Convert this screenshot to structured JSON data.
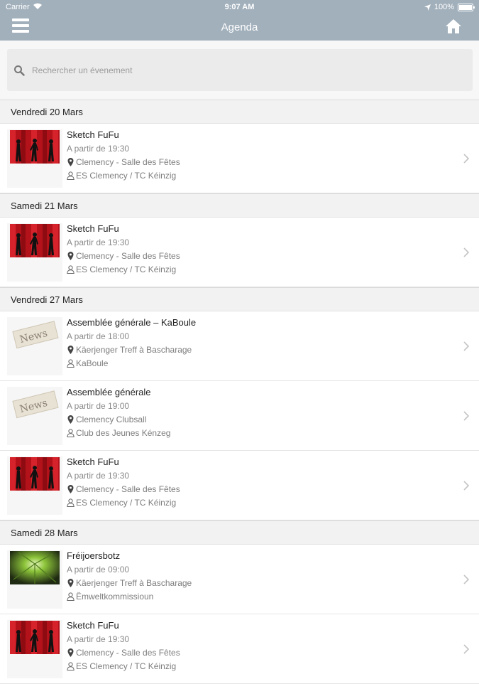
{
  "status_bar": {
    "carrier": "Carrier",
    "time": "9:07 AM",
    "battery": "100%"
  },
  "nav": {
    "title": "Agenda"
  },
  "search": {
    "placeholder": "Rechercher un évenement"
  },
  "sections": [
    {
      "date": "Vendredi 20 Mars",
      "events": [
        {
          "title": "Sketch FuFu",
          "time": "A partir de 19:30",
          "place": "Clemency - Salle des Fêtes",
          "organizer": "ES Clemency / TC Kéinzig",
          "image": "theatre"
        }
      ]
    },
    {
      "date": "Samedi 21 Mars",
      "events": [
        {
          "title": "Sketch FuFu",
          "time": "A partir de 19:30",
          "place": "Clemency - Salle des Fêtes",
          "organizer": "ES Clemency / TC Kéinzig",
          "image": "theatre"
        }
      ]
    },
    {
      "date": "Vendredi 27 Mars",
      "events": [
        {
          "title": "Assemblée générale – KaBoule",
          "time": "A partir de 18:00",
          "place": "Käerjenger Treff à Bascharage",
          "organizer": "KaBoule",
          "image": "news",
          "image_text": "News"
        },
        {
          "title": "Assemblée générale",
          "time": "A partir de 19:00",
          "place": "Clemency Clubsall",
          "organizer": "Club des Jeunes Kénzeg",
          "image": "news",
          "image_text": "News"
        },
        {
          "title": "Sketch FuFu",
          "time": "A partir de 19:30",
          "place": "Clemency - Salle des Fêtes",
          "organizer": "ES Clemency / TC Kéinzig",
          "image": "theatre"
        }
      ]
    },
    {
      "date": "Samedi 28 Mars",
      "events": [
        {
          "title": "Fréijoersbotz",
          "time": "A partir de 09:00",
          "place": "Käerjenger Treff à Bascharage",
          "organizer": "Ëmweltkommissioun",
          "image": "nature"
        },
        {
          "title": "Sketch FuFu",
          "time": "A partir de 19:30",
          "place": "Clemency - Salle des Fêtes",
          "organizer": "ES Clemency / TC Kéinzig",
          "image": "theatre"
        }
      ]
    }
  ],
  "colors": {
    "nav_bg": "#a2b0bc",
    "section_bg": "#f2f2f2",
    "search_bg": "#ebebeb"
  }
}
